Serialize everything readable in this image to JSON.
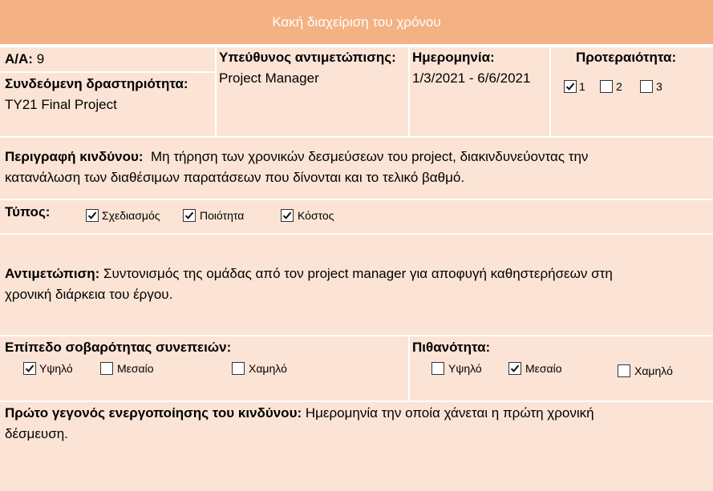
{
  "title": "Κακή διαχείριση του χρόνου",
  "aa": {
    "label": "Α/Α:",
    "value": "9"
  },
  "activity": {
    "label": "Συνδεόμενη δραστηριότητα:",
    "value": "ΤΥ21 Final Project"
  },
  "owner": {
    "label": "Υπεύθυνος αντιμετώπισης:",
    "value": "Project Manager"
  },
  "date": {
    "label": "Ημερομηνία:",
    "value": "1/3/2021 - 6/6/2021"
  },
  "priority": {
    "label": "Προτεραιότητα:",
    "options": [
      {
        "label": "1",
        "checked": true
      },
      {
        "label": "2",
        "checked": false
      },
      {
        "label": "3",
        "checked": false
      }
    ]
  },
  "description": {
    "label": "Περιγραφή κινδύνου:",
    "line1": "Μη τήρηση των χρονικών δεσμεύσεων του project, διακινδυνεύοντας την",
    "line2": "κατανάλωση των διαθέσιμων παρατάσεων που δίνονται και το τελικό βαθμό."
  },
  "type": {
    "label": "Τύπος:",
    "options": [
      {
        "label": "Σχεδιασμός",
        "checked": true
      },
      {
        "label": "Ποιότητα",
        "checked": true
      },
      {
        "label": "Κόστος",
        "checked": true
      }
    ]
  },
  "response": {
    "label": "Αντιμετώπιση:",
    "line1": "Συντονισμός της ομάδας από τον project manager για αποφυγή καθηστερήσεων στη",
    "line2": "χρονική διάρκεια του έργου."
  },
  "severity": {
    "label": "Επίπεδο σοβαρότητας συνεπειών:",
    "options": [
      {
        "label": "Υψηλό",
        "checked": true
      },
      {
        "label": "Μεσαίο",
        "checked": false
      },
      {
        "label": "Χαμηλό",
        "checked": false
      }
    ]
  },
  "probability": {
    "label": "Πιθανότητα:",
    "options": [
      {
        "label": "Υψηλό",
        "checked": false
      },
      {
        "label": "Μεσαίο",
        "checked": true
      },
      {
        "label": "Χαμηλό",
        "checked": false
      }
    ]
  },
  "trigger": {
    "label": "Πρώτο γεγονός ενεργοποίησης του κινδύνου:",
    "line1": "Ημερομηνία την οποία χάνεται η πρώτη χρονική",
    "line2": "δέσμευση."
  },
  "colors": {
    "header": "#f4b183",
    "cell": "#fbe4d5",
    "border": "#ffffff"
  }
}
